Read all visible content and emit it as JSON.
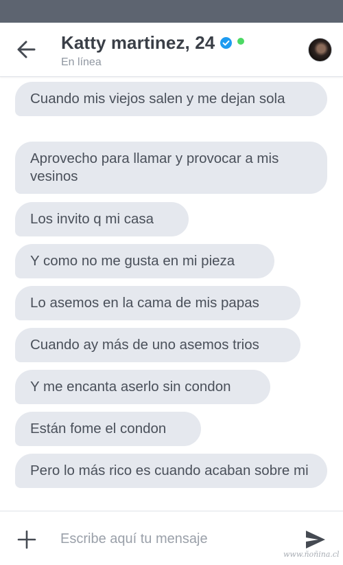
{
  "header": {
    "contact_name": "Katty martinez, 24",
    "status": "En línea",
    "verified_icon": "verified-check-icon",
    "online_color": "#4cd964"
  },
  "messages": [
    {
      "text": "Cuando mis viejos salen y me dejan sola"
    },
    {
      "text": "Aprovecho para llamar y provocar a mis vesinos"
    },
    {
      "text": "Los invito q mi casa"
    },
    {
      "text": "Y como no me gusta en mi pieza"
    },
    {
      "text": "Lo asemos en la cama de mis papas"
    },
    {
      "text": "Cuando ay más de uno asemos trios"
    },
    {
      "text": "Y me encanta aserlo sin condon"
    },
    {
      "text": "Están fome el condon"
    },
    {
      "text": "Pero lo más rico es cuando acaban sobre mi"
    }
  ],
  "composer": {
    "placeholder": "Escribe aquí tu mensaje"
  },
  "watermark": "www.ñoñina.cl",
  "colors": {
    "status_bar": "#5d6470",
    "bubble_bg": "#e5e8ee",
    "bubble_text": "#4a505a"
  }
}
